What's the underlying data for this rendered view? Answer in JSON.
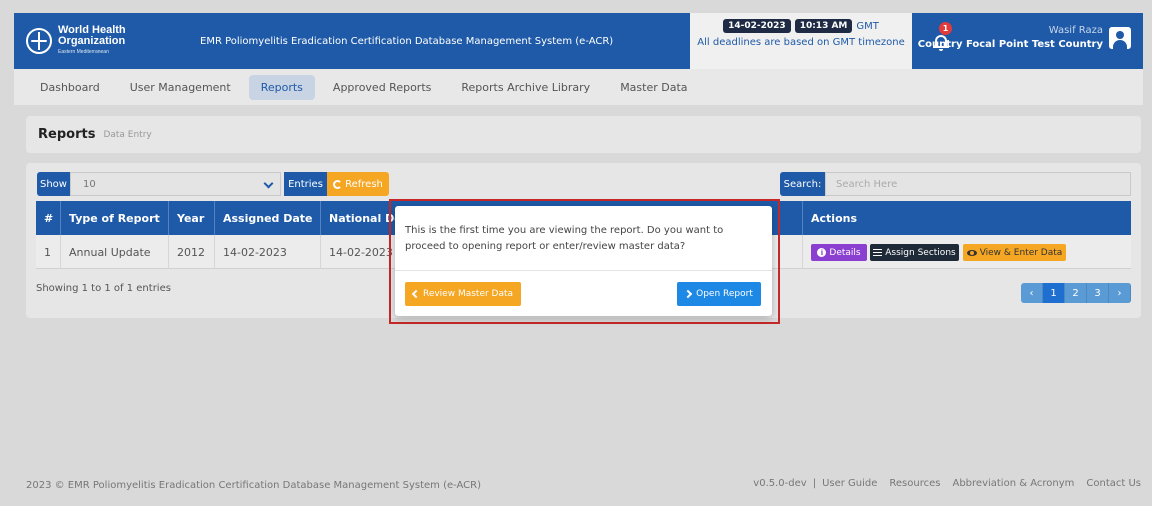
{
  "header": {
    "org_line1": "World Health",
    "org_line2": "Organization",
    "org_region": "Eastern Mediterranean",
    "app_title": "EMR Poliomyelitis Eradication Certification Database Management System (e-ACR)",
    "date": "14-02-2023",
    "time": "10:13 AM",
    "timezone": "GMT",
    "deadline_note": "All deadlines are based on GMT timezone",
    "notification_count": "1",
    "user_name": "Wasif Raza",
    "user_role": "Country Focal Point Test Country"
  },
  "nav": {
    "items": [
      {
        "label": "Dashboard"
      },
      {
        "label": "User Management"
      },
      {
        "label": "Reports"
      },
      {
        "label": "Approved Reports"
      },
      {
        "label": "Reports Archive Library"
      },
      {
        "label": "Master Data"
      }
    ],
    "active": "Reports"
  },
  "page": {
    "title": "Reports",
    "subtitle": "Data Entry"
  },
  "toolbar": {
    "show_label": "Show",
    "show_value": "10",
    "entries_label": "Entries",
    "refresh_label": "Refresh",
    "search_label": "Search:",
    "search_placeholder": "Search Here"
  },
  "table": {
    "columns": [
      "#",
      "Type of Report",
      "Year",
      "Assigned Date",
      "National Dea",
      "Actions"
    ],
    "rows": [
      {
        "num": "1",
        "type": "Annual Update",
        "year": "2012",
        "assigned": "14-02-2023",
        "national": "14-02-2023"
      }
    ],
    "actions": {
      "details": "Details",
      "assign": "Assign Sections",
      "view": "View & Enter Data"
    },
    "showing": "Showing 1 to 1 of 1 entries",
    "pages": [
      "1",
      "2",
      "3"
    ]
  },
  "modal": {
    "message": "This is the first time you are viewing the report. Do you want to proceed to opening report or enter/review master data?",
    "review_label": "Review Master Data",
    "open_label": "Open Report"
  },
  "footer": {
    "copyright": "2023 ©  EMR Poliomyelitis Eradication Certification Database Management System (e-ACR)",
    "version": "v0.5.0-dev",
    "separator": "|",
    "links": [
      "User Guide",
      "Resources",
      "Abbreviation & Acronym",
      "Contact Us"
    ]
  },
  "colors": {
    "primary": "#1e5aa8",
    "accent_orange": "#f5a623",
    "purple": "#8a3fd1",
    "highlight_red": "#c62828"
  }
}
